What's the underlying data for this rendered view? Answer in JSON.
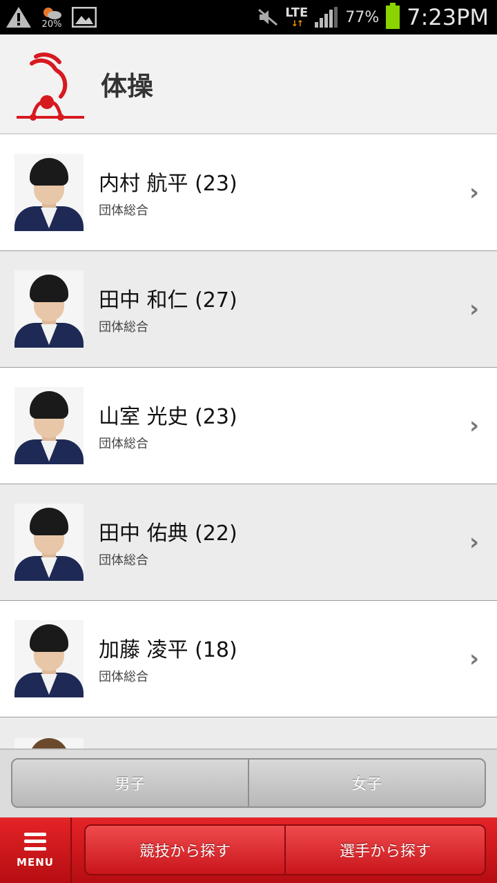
{
  "status_bar": {
    "weather_percent": "20%",
    "network": "LTE",
    "battery": "77%",
    "time": "7:23PM"
  },
  "header": {
    "title": "体操",
    "logo_icon": "gymnastics-logo"
  },
  "athletes": [
    {
      "name": "内村 航平 (23)",
      "event": "団体総合"
    },
    {
      "name": "田中 和仁 (27)",
      "event": "団体総合"
    },
    {
      "name": "山室 光史 (23)",
      "event": "団体総合"
    },
    {
      "name": "田中 佑典 (22)",
      "event": "団体総合"
    },
    {
      "name": "加藤 凌平 (18)",
      "event": "団体総合"
    }
  ],
  "segment": {
    "men": "男子",
    "women": "女子"
  },
  "bottom_bar": {
    "menu_label": "MENU",
    "search_by_event": "競技から探す",
    "search_by_athlete": "選手から探す"
  },
  "colors": {
    "brand_red": "#d71920",
    "alt_row": "#ececec"
  }
}
